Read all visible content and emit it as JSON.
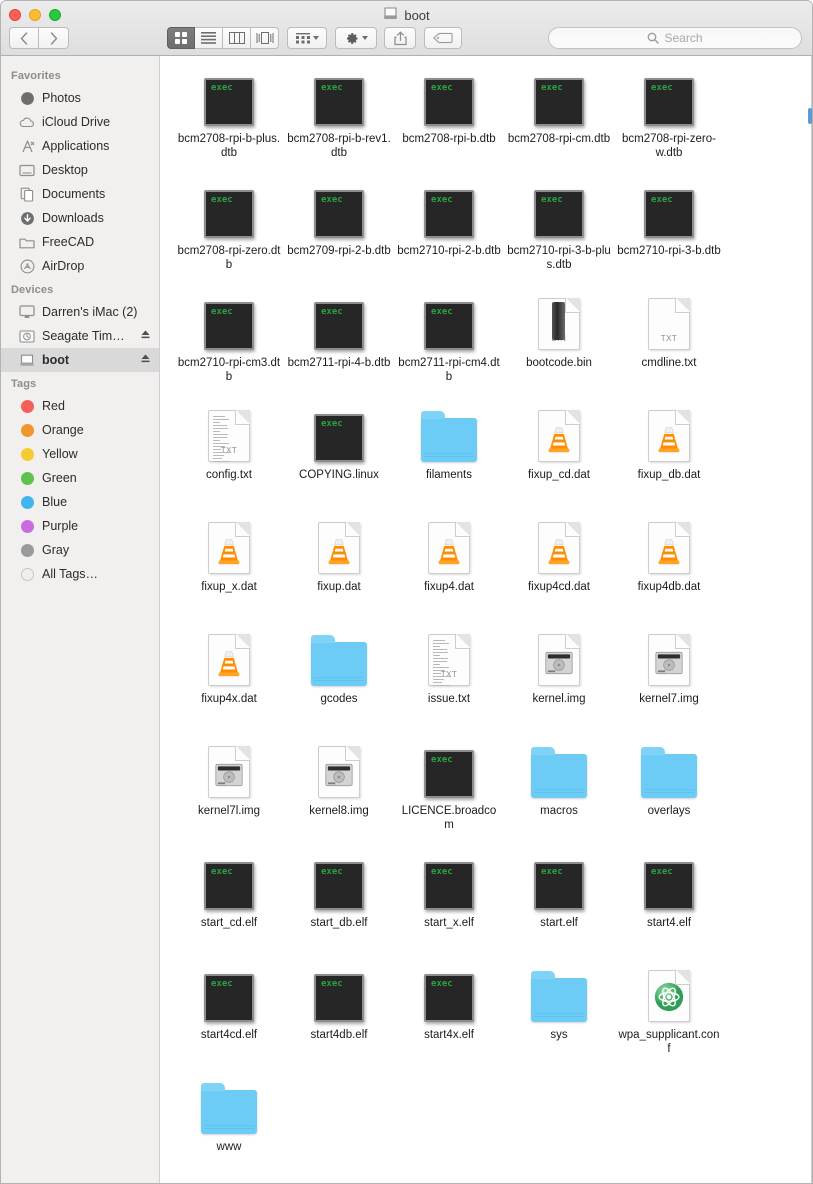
{
  "window": {
    "title": "boot",
    "title_icon": "drive-icon",
    "traffic_lights": [
      {
        "name": "close",
        "color": "#ff5f57"
      },
      {
        "name": "minimize",
        "color": "#febc2e"
      },
      {
        "name": "zoom",
        "color": "#28c840"
      }
    ]
  },
  "toolbar": {
    "back_label": "‹",
    "forward_label": "›",
    "view_modes": [
      {
        "name": "icon-view",
        "label": "icon",
        "active": true
      },
      {
        "name": "list-view",
        "label": "list",
        "active": false
      },
      {
        "name": "column-view",
        "label": "column",
        "active": false
      },
      {
        "name": "gallery-view",
        "label": "gallery",
        "active": false
      }
    ],
    "arrange_label": "",
    "action_label": "",
    "share_label": "",
    "tag_label": ""
  },
  "search": {
    "placeholder": "Search",
    "value": ""
  },
  "sidebar": {
    "sections": [
      {
        "heading": "Favorites",
        "items": [
          {
            "label": "Photos",
            "icon": "photos-icon",
            "eject": false,
            "selected": false
          },
          {
            "label": "iCloud Drive",
            "icon": "icloud-icon",
            "eject": false,
            "selected": false
          },
          {
            "label": "Applications",
            "icon": "applications-icon",
            "eject": false,
            "selected": false
          },
          {
            "label": "Desktop",
            "icon": "desktop-icon",
            "eject": false,
            "selected": false
          },
          {
            "label": "Documents",
            "icon": "documents-icon",
            "eject": false,
            "selected": false
          },
          {
            "label": "Downloads",
            "icon": "downloads-icon",
            "eject": false,
            "selected": false
          },
          {
            "label": "FreeCAD",
            "icon": "folder-icon",
            "eject": false,
            "selected": false
          },
          {
            "label": "AirDrop",
            "icon": "airdrop-icon",
            "eject": false,
            "selected": false
          }
        ]
      },
      {
        "heading": "Devices",
        "items": [
          {
            "label": "Darren's iMac (2)",
            "icon": "imac-icon",
            "eject": false,
            "selected": false
          },
          {
            "label": "Seagate Tim…",
            "icon": "timemachine-disk-icon",
            "eject": true,
            "selected": false
          },
          {
            "label": "boot",
            "icon": "drive-icon",
            "eject": true,
            "selected": true
          }
        ]
      },
      {
        "heading": "Tags",
        "items": [
          {
            "label": "Red",
            "icon": "tag-dot-icon",
            "color": "#f5605a",
            "eject": false,
            "selected": false
          },
          {
            "label": "Orange",
            "icon": "tag-dot-icon",
            "color": "#f0962d",
            "eject": false,
            "selected": false
          },
          {
            "label": "Yellow",
            "icon": "tag-dot-icon",
            "color": "#f5cb34",
            "eject": false,
            "selected": false
          },
          {
            "label": "Green",
            "icon": "tag-dot-icon",
            "color": "#5fc24f",
            "eject": false,
            "selected": false
          },
          {
            "label": "Blue",
            "icon": "tag-dot-icon",
            "color": "#41b5f0",
            "eject": false,
            "selected": false
          },
          {
            "label": "Purple",
            "icon": "tag-dot-icon",
            "color": "#cc6ae0",
            "eject": false,
            "selected": false
          },
          {
            "label": "Gray",
            "icon": "tag-dot-icon",
            "color": "#9a9a9a",
            "eject": false,
            "selected": false
          },
          {
            "label": "All Tags…",
            "icon": "all-tags-icon",
            "color": "#e8e8e8",
            "eject": false,
            "selected": false
          }
        ]
      }
    ]
  },
  "files": [
    {
      "name": "bcm2708-rpi-b-plus.dtb",
      "icon": "exec-icon"
    },
    {
      "name": "bcm2708-rpi-b-rev1.dtb",
      "icon": "exec-icon"
    },
    {
      "name": "bcm2708-rpi-b.dtb",
      "icon": "exec-icon"
    },
    {
      "name": "bcm2708-rpi-cm.dtb",
      "icon": "exec-icon"
    },
    {
      "name": "bcm2708-rpi-zero-w.dtb",
      "icon": "exec-icon"
    },
    {
      "name": "bcm2708-rpi-zero.dtb",
      "icon": "exec-icon"
    },
    {
      "name": "bcm2709-rpi-2-b.dtb",
      "icon": "exec-icon"
    },
    {
      "name": "bcm2710-rpi-2-b.dtb",
      "icon": "exec-icon"
    },
    {
      "name": "bcm2710-rpi-3-b-plus.dtb",
      "icon": "exec-icon"
    },
    {
      "name": "bcm2710-rpi-3-b.dtb",
      "icon": "exec-icon"
    },
    {
      "name": "bcm2710-rpi-cm3.dtb",
      "icon": "exec-icon"
    },
    {
      "name": "bcm2711-rpi-4-b.dtb",
      "icon": "exec-icon"
    },
    {
      "name": "bcm2711-rpi-cm4.dtb",
      "icon": "exec-icon"
    },
    {
      "name": "bootcode.bin",
      "icon": "bin-doc-icon",
      "badge": "BIN"
    },
    {
      "name": "cmdline.txt",
      "icon": "txt-doc-icon",
      "badge": "TXT"
    },
    {
      "name": "config.txt",
      "icon": "txt-preview-doc-icon",
      "badge": "TXT"
    },
    {
      "name": "COPYING.linux",
      "icon": "exec-icon"
    },
    {
      "name": "filaments",
      "icon": "folder-icon"
    },
    {
      "name": "fixup_cd.dat",
      "icon": "vlc-doc-icon"
    },
    {
      "name": "fixup_db.dat",
      "icon": "vlc-doc-icon"
    },
    {
      "name": "fixup_x.dat",
      "icon": "vlc-doc-icon"
    },
    {
      "name": "fixup.dat",
      "icon": "vlc-doc-icon"
    },
    {
      "name": "fixup4.dat",
      "icon": "vlc-doc-icon"
    },
    {
      "name": "fixup4cd.dat",
      "icon": "vlc-doc-icon"
    },
    {
      "name": "fixup4db.dat",
      "icon": "vlc-doc-icon"
    },
    {
      "name": "fixup4x.dat",
      "icon": "vlc-doc-icon"
    },
    {
      "name": "gcodes",
      "icon": "folder-icon"
    },
    {
      "name": "issue.txt",
      "icon": "txt-preview-doc-icon",
      "badge": "TXT"
    },
    {
      "name": "kernel.img",
      "icon": "disk-image-doc-icon"
    },
    {
      "name": "kernel7.img",
      "icon": "disk-image-doc-icon"
    },
    {
      "name": "kernel7l.img",
      "icon": "disk-image-doc-icon"
    },
    {
      "name": "kernel8.img",
      "icon": "disk-image-doc-icon"
    },
    {
      "name": "LICENCE.broadcom",
      "icon": "exec-icon"
    },
    {
      "name": "macros",
      "icon": "folder-icon"
    },
    {
      "name": "overlays",
      "icon": "folder-icon"
    },
    {
      "name": "start_cd.elf",
      "icon": "exec-icon"
    },
    {
      "name": "start_db.elf",
      "icon": "exec-icon"
    },
    {
      "name": "start_x.elf",
      "icon": "exec-icon"
    },
    {
      "name": "start.elf",
      "icon": "exec-icon"
    },
    {
      "name": "start4.elf",
      "icon": "exec-icon"
    },
    {
      "name": "start4cd.elf",
      "icon": "exec-icon"
    },
    {
      "name": "start4db.elf",
      "icon": "exec-icon"
    },
    {
      "name": "start4x.elf",
      "icon": "exec-icon"
    },
    {
      "name": "sys",
      "icon": "folder-icon"
    },
    {
      "name": "wpa_supplicant.conf",
      "icon": "atom-doc-icon"
    },
    {
      "name": "www",
      "icon": "folder-icon"
    }
  ]
}
